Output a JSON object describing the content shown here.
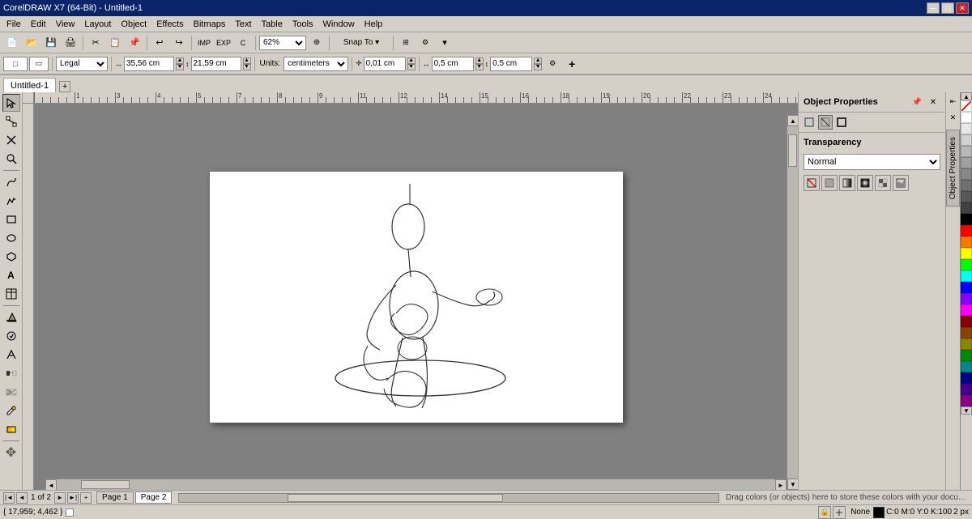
{
  "titlebar": {
    "title": "CorelDRAW X7 (64-Bit) - Untitled-1",
    "min_btn": "─",
    "max_btn": "□",
    "close_btn": "✕"
  },
  "menubar": {
    "items": [
      "File",
      "Edit",
      "View",
      "Layout",
      "Object",
      "Effects",
      "Bitmaps",
      "Text",
      "Table",
      "Tools",
      "Window",
      "Help"
    ]
  },
  "toolbar1": {
    "zoom_value": "62%",
    "snap_label": "Snap To ▾"
  },
  "toolbar2": {
    "style_label": "Legal",
    "width_value": "35,56 cm",
    "height_value": "21,59 cm",
    "units_label": "Units:",
    "units_value": "centimeters",
    "nudge_value": "0,01 cm",
    "x_value": "0,5 cm",
    "y_value": "0,5 cm"
  },
  "tabs": {
    "items": [
      {
        "label": "Untitled-1",
        "active": true
      }
    ],
    "add_label": "+"
  },
  "properties_panel": {
    "title": "Object Properties",
    "transparency_label": "Transparency",
    "transparency_options": [
      "Normal",
      "Uniform",
      "Fountain",
      "Texture"
    ],
    "transparency_selected": "Normal"
  },
  "statusbar": {
    "coords": "{ 17,959; 4,462 }",
    "pages": "1 of 2",
    "page1_label": "Page 1",
    "page2_label": "Page 2",
    "hint": "Drag colors (or objects) here to store these colors with your document",
    "color_mode": "C:0 M:0 Y:0 K:100",
    "outline": "None",
    "pt": "2 px"
  },
  "colors": {
    "palette": [
      "#ff0000",
      "#ff7700",
      "#ffff00",
      "#00ff00",
      "#00ffff",
      "#0000ff",
      "#8800ff",
      "#ff00ff",
      "#ffffff",
      "#c8c8c8",
      "#888888",
      "#333333",
      "#000000",
      "#ffcccc",
      "#ffe0cc",
      "#ffffcc",
      "#ccffcc",
      "#ccffff",
      "#cce0ff",
      "#e0ccff",
      "#ffccff",
      "#993300",
      "#996600",
      "#669900",
      "#006666",
      "#003399",
      "#660099",
      "#990066",
      "#ff6666",
      "#ff9966"
    ]
  }
}
